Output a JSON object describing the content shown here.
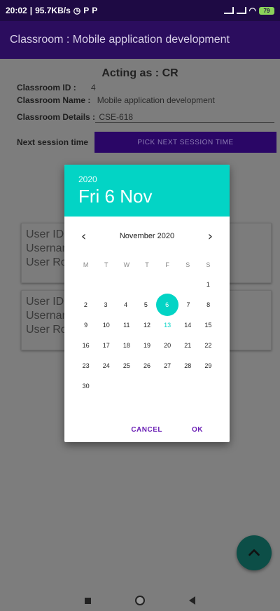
{
  "status_bar": {
    "time": "20:02",
    "speed": "95.7KB/s",
    "battery": "79"
  },
  "app_bar": {
    "title": "Classroom : Mobile application development"
  },
  "main": {
    "acting_as": "Acting as : CR",
    "classroom_id_label": "Classroom ID :",
    "classroom_id_value": "4",
    "classroom_name_label": "Classroom Name :",
    "classroom_name_value": "Mobile application development",
    "classroom_details_label": "Classroom Details :",
    "classroom_details_value": "CSE-618",
    "next_session_label": "Next session time",
    "pick_button_label": "PICK NEXT SESSION TIME",
    "cards": [
      {
        "line1": "User ID :",
        "line2": "Usernam",
        "line3": "User Rol"
      },
      {
        "line1": "User ID :",
        "line2": "Usernam",
        "line3": "User Rol"
      }
    ]
  },
  "date_picker": {
    "year": "2020",
    "selected_date": "Fri 6 Nov",
    "month_label": "November 2020",
    "prev_icon": "chevron-left-icon",
    "next_icon": "chevron-right-icon",
    "weekdays": [
      "M",
      "T",
      "W",
      "T",
      "F",
      "S",
      "S"
    ],
    "weeks": [
      [
        "",
        "",
        "",
        "",
        "",
        "",
        "1"
      ],
      [
        "2",
        "3",
        "4",
        "5",
        "6",
        "7",
        "8"
      ],
      [
        "9",
        "10",
        "11",
        "12",
        "13",
        "14",
        "15"
      ],
      [
        "16",
        "17",
        "18",
        "19",
        "20",
        "21",
        "22"
      ],
      [
        "23",
        "24",
        "25",
        "26",
        "27",
        "28",
        "29"
      ],
      [
        "30",
        "",
        "",
        "",
        "",
        "",
        ""
      ]
    ],
    "selected_day": "6",
    "today_day": "13",
    "cancel_label": "CANCEL",
    "ok_label": "OK",
    "accent_color": "#03d4c5"
  }
}
